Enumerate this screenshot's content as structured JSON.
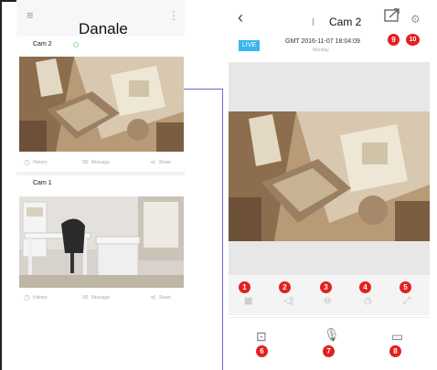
{
  "left_app": {
    "title": "Danale",
    "cards": [
      {
        "name": "Cam 2",
        "actions": [
          "History",
          "Message",
          "Share"
        ]
      },
      {
        "name": "Cam 1",
        "actions": [
          "History",
          "Message",
          "Share"
        ]
      }
    ]
  },
  "right_app": {
    "title": "Cam 2",
    "live_label": "LIVE",
    "timestamp": "GMT 2016-11-07 18:04:09",
    "weekday": "Monday"
  },
  "markers": [
    "1",
    "2",
    "3",
    "4",
    "5",
    "6",
    "7",
    "8",
    "9",
    "10"
  ],
  "colors": {
    "marker": "#e3201f",
    "live": "#39b6ee",
    "connector": "#6b6bd6"
  },
  "icons": [
    "menu-icon",
    "more-icon",
    "back-icon",
    "share-icon",
    "gear-icon",
    "grid-icon",
    "speaker-icon",
    "zoom-icon",
    "clock-icon",
    "fullscreen-icon",
    "camera-icon",
    "microphone-icon",
    "record-icon"
  ]
}
